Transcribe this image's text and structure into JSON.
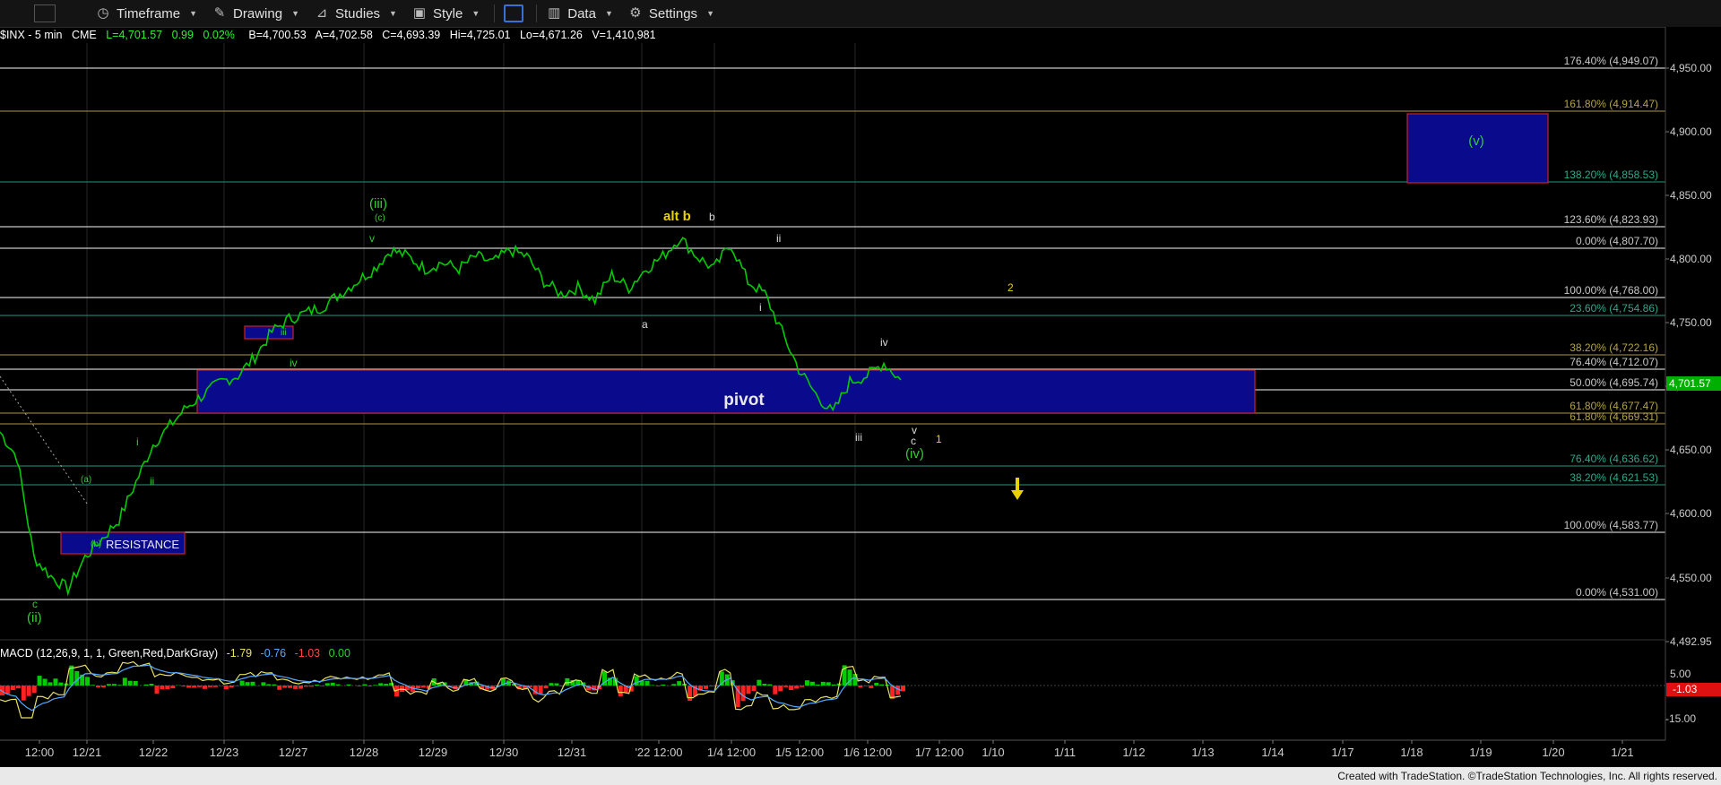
{
  "toolbar": {
    "timeframe": "Timeframe",
    "drawing": "Drawing",
    "studies": "Studies",
    "style": "Style",
    "data": "Data",
    "settings": "Settings"
  },
  "symbol_info": {
    "symbol": "$INX - 5 min",
    "exchange": "CME",
    "last": "L=4,701.57",
    "change": "0.99",
    "change_pct": "0.02%",
    "bid": "B=4,700.53",
    "ask": "A=4,702.58",
    "close": "C=4,693.39",
    "high": "Hi=4,725.01",
    "low": "Lo=4,671.26",
    "volume": "V=1,410,981"
  },
  "colors": {
    "up": "#00cc00",
    "down": "#ff2222",
    "zone_fill": "#0a0a8c",
    "zone_border": "#cc2222",
    "wave_green": "#33cc33",
    "wave_yellow": "#e8d200",
    "price_tag": "#00b000",
    "macd_tag": "#dd1111"
  },
  "price_axis": {
    "labels": [
      "4,950.00",
      "4,900.00",
      "4,850.00",
      "4,800.00",
      "4,750.00",
      "4,700.00",
      "4,650.00",
      "4,600.00",
      "4,550.00",
      "4,492.95"
    ],
    "last_price": "4,701.57"
  },
  "fib_levels": [
    {
      "label": "176.40% (4,949.07)",
      "color": "#c8c8c8"
    },
    {
      "label": "161.80% (4,914.47)",
      "color": "#b4a24a"
    },
    {
      "label": "138.20% (4,858.53)",
      "color": "#2fa88a"
    },
    {
      "label": "123.60% (4,823.93)",
      "color": "#c8c8c8"
    },
    {
      "label": "0.00% (4,807.70)",
      "color": "#c8c8c8"
    },
    {
      "label": "100.00% (4,768.00)",
      "color": "#c8c8c8"
    },
    {
      "label": "23.60% (4,754.86)",
      "color": "#2fa88a"
    },
    {
      "label": "38.20% (4,722.16)",
      "color": "#b4a24a"
    },
    {
      "label": "76.40% (4,712.07)",
      "color": "#c8c8c8"
    },
    {
      "label": "50.00% (4,695.74)",
      "color": "#c8c8c8"
    },
    {
      "label": "61.80% (4,677.47)",
      "color": "#b4a24a"
    },
    {
      "label": "61.80% (4,669.31)",
      "color": "#b4a24a"
    },
    {
      "label": "76.40% (4,636.62)",
      "color": "#2fa88a"
    },
    {
      "label": "38.20% (4,621.53)",
      "color": "#2fa88a"
    },
    {
      "label": "100.00% (4,583.77)",
      "color": "#c8c8c8"
    },
    {
      "label": "0.00% (4,531.00)",
      "color": "#c8c8c8"
    }
  ],
  "zones": {
    "pivot": "pivot",
    "resistance": "RESISTANCE",
    "target_v": "(v)",
    "small_iii": "iii"
  },
  "wave_labels": {
    "ii_main": "(ii)",
    "c_low": "c",
    "a_small": "(a)",
    "b_small": "(b)",
    "i_small": "i",
    "ii_small": "ii",
    "iv_small": "iv",
    "iii_main": "(iii)",
    "c_small": "(c)",
    "v_small": "v",
    "alt_b": "alt b",
    "b_top": "b",
    "a_mid": "a",
    "ii_top": "ii",
    "i_mid": "i",
    "iii_low": "iii",
    "iv_right": "iv",
    "v_right": "v",
    "c_right": "c",
    "iv_main": "(iv)",
    "one_yellow": "1",
    "two_yellow": "2"
  },
  "macd": {
    "title": "MACD (12,26,9, 1, 1, Green,Red,DarkGray)",
    "v1": "-1.79",
    "v2": "-0.76",
    "v3": "-1.03",
    "v4": "0.00",
    "axis": [
      "5.00",
      "-15.00"
    ],
    "tag": "-1.03"
  },
  "time_axis": [
    "12:00",
    "12/21",
    "12/22",
    "12/23",
    "12/27",
    "12/28",
    "12/29",
    "12/30",
    "12/31",
    "'22 12:00",
    "1/4 12:00",
    "1/5 12:00",
    "1/6 12:00",
    "1/7 12:00",
    "1/10",
    "1/11",
    "1/12",
    "1/13",
    "1/14",
    "1/17",
    "1/18",
    "1/19",
    "1/20",
    "1/21"
  ],
  "credit": "Created with TradeStation. ©TradeStation Technologies, Inc. All rights reserved.",
  "chart_data": {
    "type": "line",
    "title": "",
    "series": [
      {
        "name": "$INX - 5 min",
        "values": [
          4660,
          4640,
          4560,
          4545,
          4535,
          4560,
          4575,
          4590,
          4620,
          4650,
          4665,
          4680,
          4690,
          4700,
          4705,
          4720,
          4740,
          4750,
          4755,
          4760,
          4770,
          4780,
          4790,
          4805,
          4800,
          4790,
          4795,
          4790,
          4800,
          4795,
          4805,
          4800,
          4780,
          4770,
          4775,
          4765,
          4785,
          4775,
          4790,
          4800,
          4815,
          4800,
          4790,
          4810,
          4780,
          4770,
          4740,
          4710,
          4690,
          4675,
          4700,
          4705,
          4715,
          4701.57
        ]
      }
    ],
    "ylim": [
      4492.95,
      4970
    ],
    "ticks": [
      "4,950.00",
      "4,900.00",
      "4,850.00",
      "4,800.00",
      "4,750.00",
      "4,700.00",
      "4,650.00",
      "4,600.00",
      "4,550.00"
    ]
  }
}
